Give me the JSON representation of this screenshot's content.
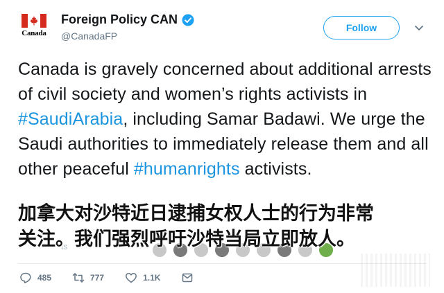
{
  "header": {
    "avatar_text": "Canada",
    "display_name": "Foreign Policy CAN",
    "handle": "@CanadaFP",
    "follow_label": "Follow"
  },
  "tweet": {
    "text_before_1": "Canada is gravely concerned about additional arrests of civil society and women’s rights activists in ",
    "hashtag_1": "#SaudiArabia",
    "text_between": ", including Samar Badawi. We urge the Saudi authorities to immediately release them and all other peaceful ",
    "hashtag_2": "#humanrights",
    "text_after_2": " activists."
  },
  "caption": {
    "line_1": "加拿大对沙特近日逮捕女权人士的行为非常",
    "line_2": "关注。我们强烈呼吁沙特当局立即放人。"
  },
  "faint_timestamp": "ts",
  "actions": {
    "replies": "485",
    "retweets": "777",
    "likes": "1.1K"
  },
  "colors": {
    "accent": "#1da1f2",
    "hashtag": "#1b95e0",
    "muted": "#657786",
    "flag_red": "#d52b1e"
  },
  "icons": [
    "canada-flag-icon",
    "verified-icon",
    "chevron-down-icon",
    "reply-icon",
    "retweet-icon",
    "like-icon",
    "message-icon"
  ]
}
